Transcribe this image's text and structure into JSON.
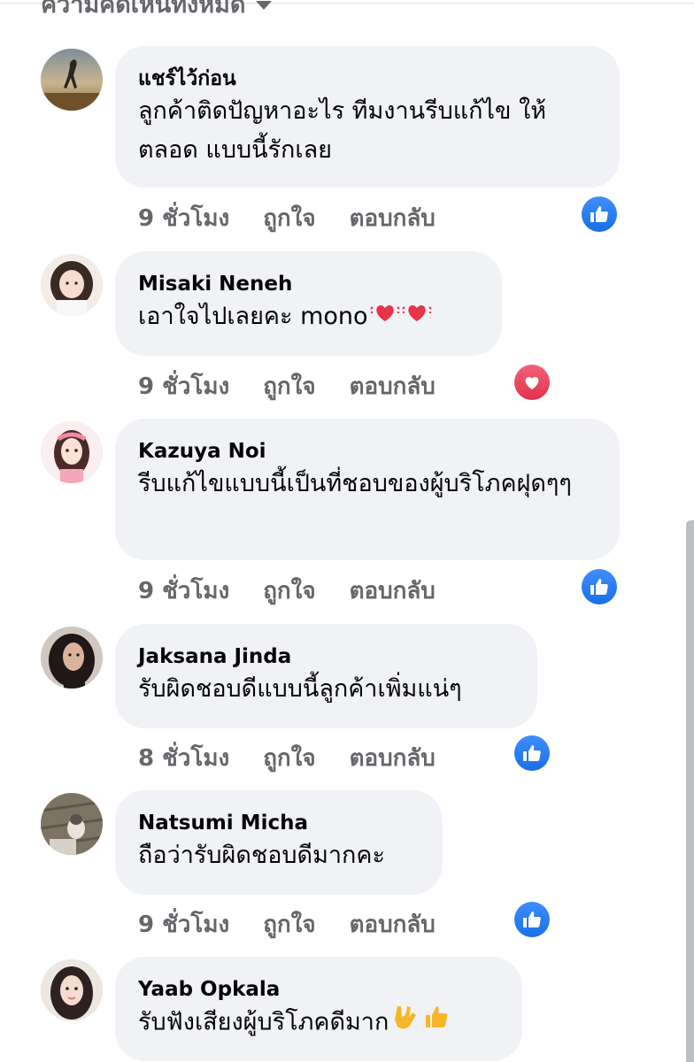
{
  "header": {
    "title": "ความคิดเห็นทั้งหมด",
    "dropdown_icon": "chevron-down-icon"
  },
  "actions": {
    "like_label": "ถูกใจ",
    "reply_label": "ตอบกลับ"
  },
  "colors": {
    "bubble_bg": "#f0f2f5",
    "meta_text": "#65676b",
    "like_blue": "#1877f2",
    "love_red": "#f33e58"
  },
  "comments": [
    {
      "author": "แชร์ไว้ก่อน",
      "text": "ลูกค้าติดปัญหาอะไร ทีมงานรีบแก้ไข ให้ตลอด แบบนี้รักเลย",
      "time": "9 ชั่วโมง",
      "reaction": "like-icon"
    },
    {
      "author": "Misaki Neneh",
      "text": "เอาใจไปเลยคะ mono",
      "emojis": [
        "vibrating-heart-emoji",
        "vibrating-heart-emoji"
      ],
      "time": "9 ชั่วโมง",
      "reaction": "love-icon"
    },
    {
      "author": "Kazuya Noi",
      "text": "รีบแก้ไขแบบนี้เป็นที่ชอบของผู้บริโภคฝุดๆๆ",
      "time": "9 ชั่วโมง",
      "reaction": "like-icon"
    },
    {
      "author": "Jaksana Jinda",
      "text": "รับผิดชอบดีแบบนี้ลูกค้าเพิ่มแน่ๆ",
      "time": "8 ชั่วโมง",
      "reaction": "like-icon"
    },
    {
      "author": "Natsumi Micha",
      "text": "ถือว่ารับผิดชอบดีมากคะ",
      "time": "9 ชั่วโมง",
      "reaction": "like-icon"
    },
    {
      "author": "Yaab Opkala",
      "text": "รับฟังเสียงผู้บริโภคดีมาก",
      "emojis": [
        "love-you-gesture-emoji",
        "thumbs-up-emoji"
      ]
    }
  ]
}
